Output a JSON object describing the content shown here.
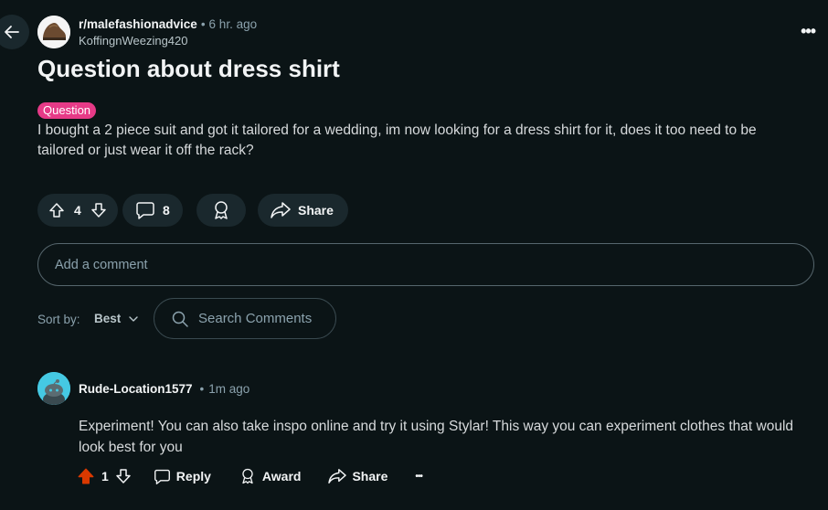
{
  "post": {
    "subreddit": "r/malefashionadvice",
    "separator": "•",
    "time": "6 hr. ago",
    "author": "KoffingnWeezing420",
    "title": "Question about dress shirt",
    "flair": "Question",
    "flair_color": "#e63a87",
    "body": "I bought a 2 piece suit and got it tailored for a wedding, im now looking for a dress shirt for it, does it too need to be tailored or just wear it off the rack?",
    "votes": "4",
    "comments": "8",
    "share_label": "Share",
    "more_label": "•••"
  },
  "comment_box": {
    "placeholder": "Add a comment"
  },
  "sort": {
    "label": "Sort by:",
    "value": "Best"
  },
  "search": {
    "placeholder": "Search Comments"
  },
  "comment": {
    "author": "Rude-Location1577",
    "separator": "•",
    "time": "1m ago",
    "body": "Experiment! You can also take inspo online and try it using Stylar! This way you can experiment clothes that would look best for you",
    "votes": "1",
    "reply_label": "Reply",
    "award_label": "Award",
    "share_label": "Share",
    "more_label": "•••",
    "upvote_color": "#d93900"
  },
  "colors": {
    "background": "#0b1416",
    "pill": "#1a282d"
  },
  "icons": [
    "back-arrow-icon",
    "upvote-icon",
    "downvote-icon",
    "comment-icon",
    "award-icon",
    "share-icon",
    "search-icon",
    "chevron-down-icon",
    "more-icon"
  ]
}
